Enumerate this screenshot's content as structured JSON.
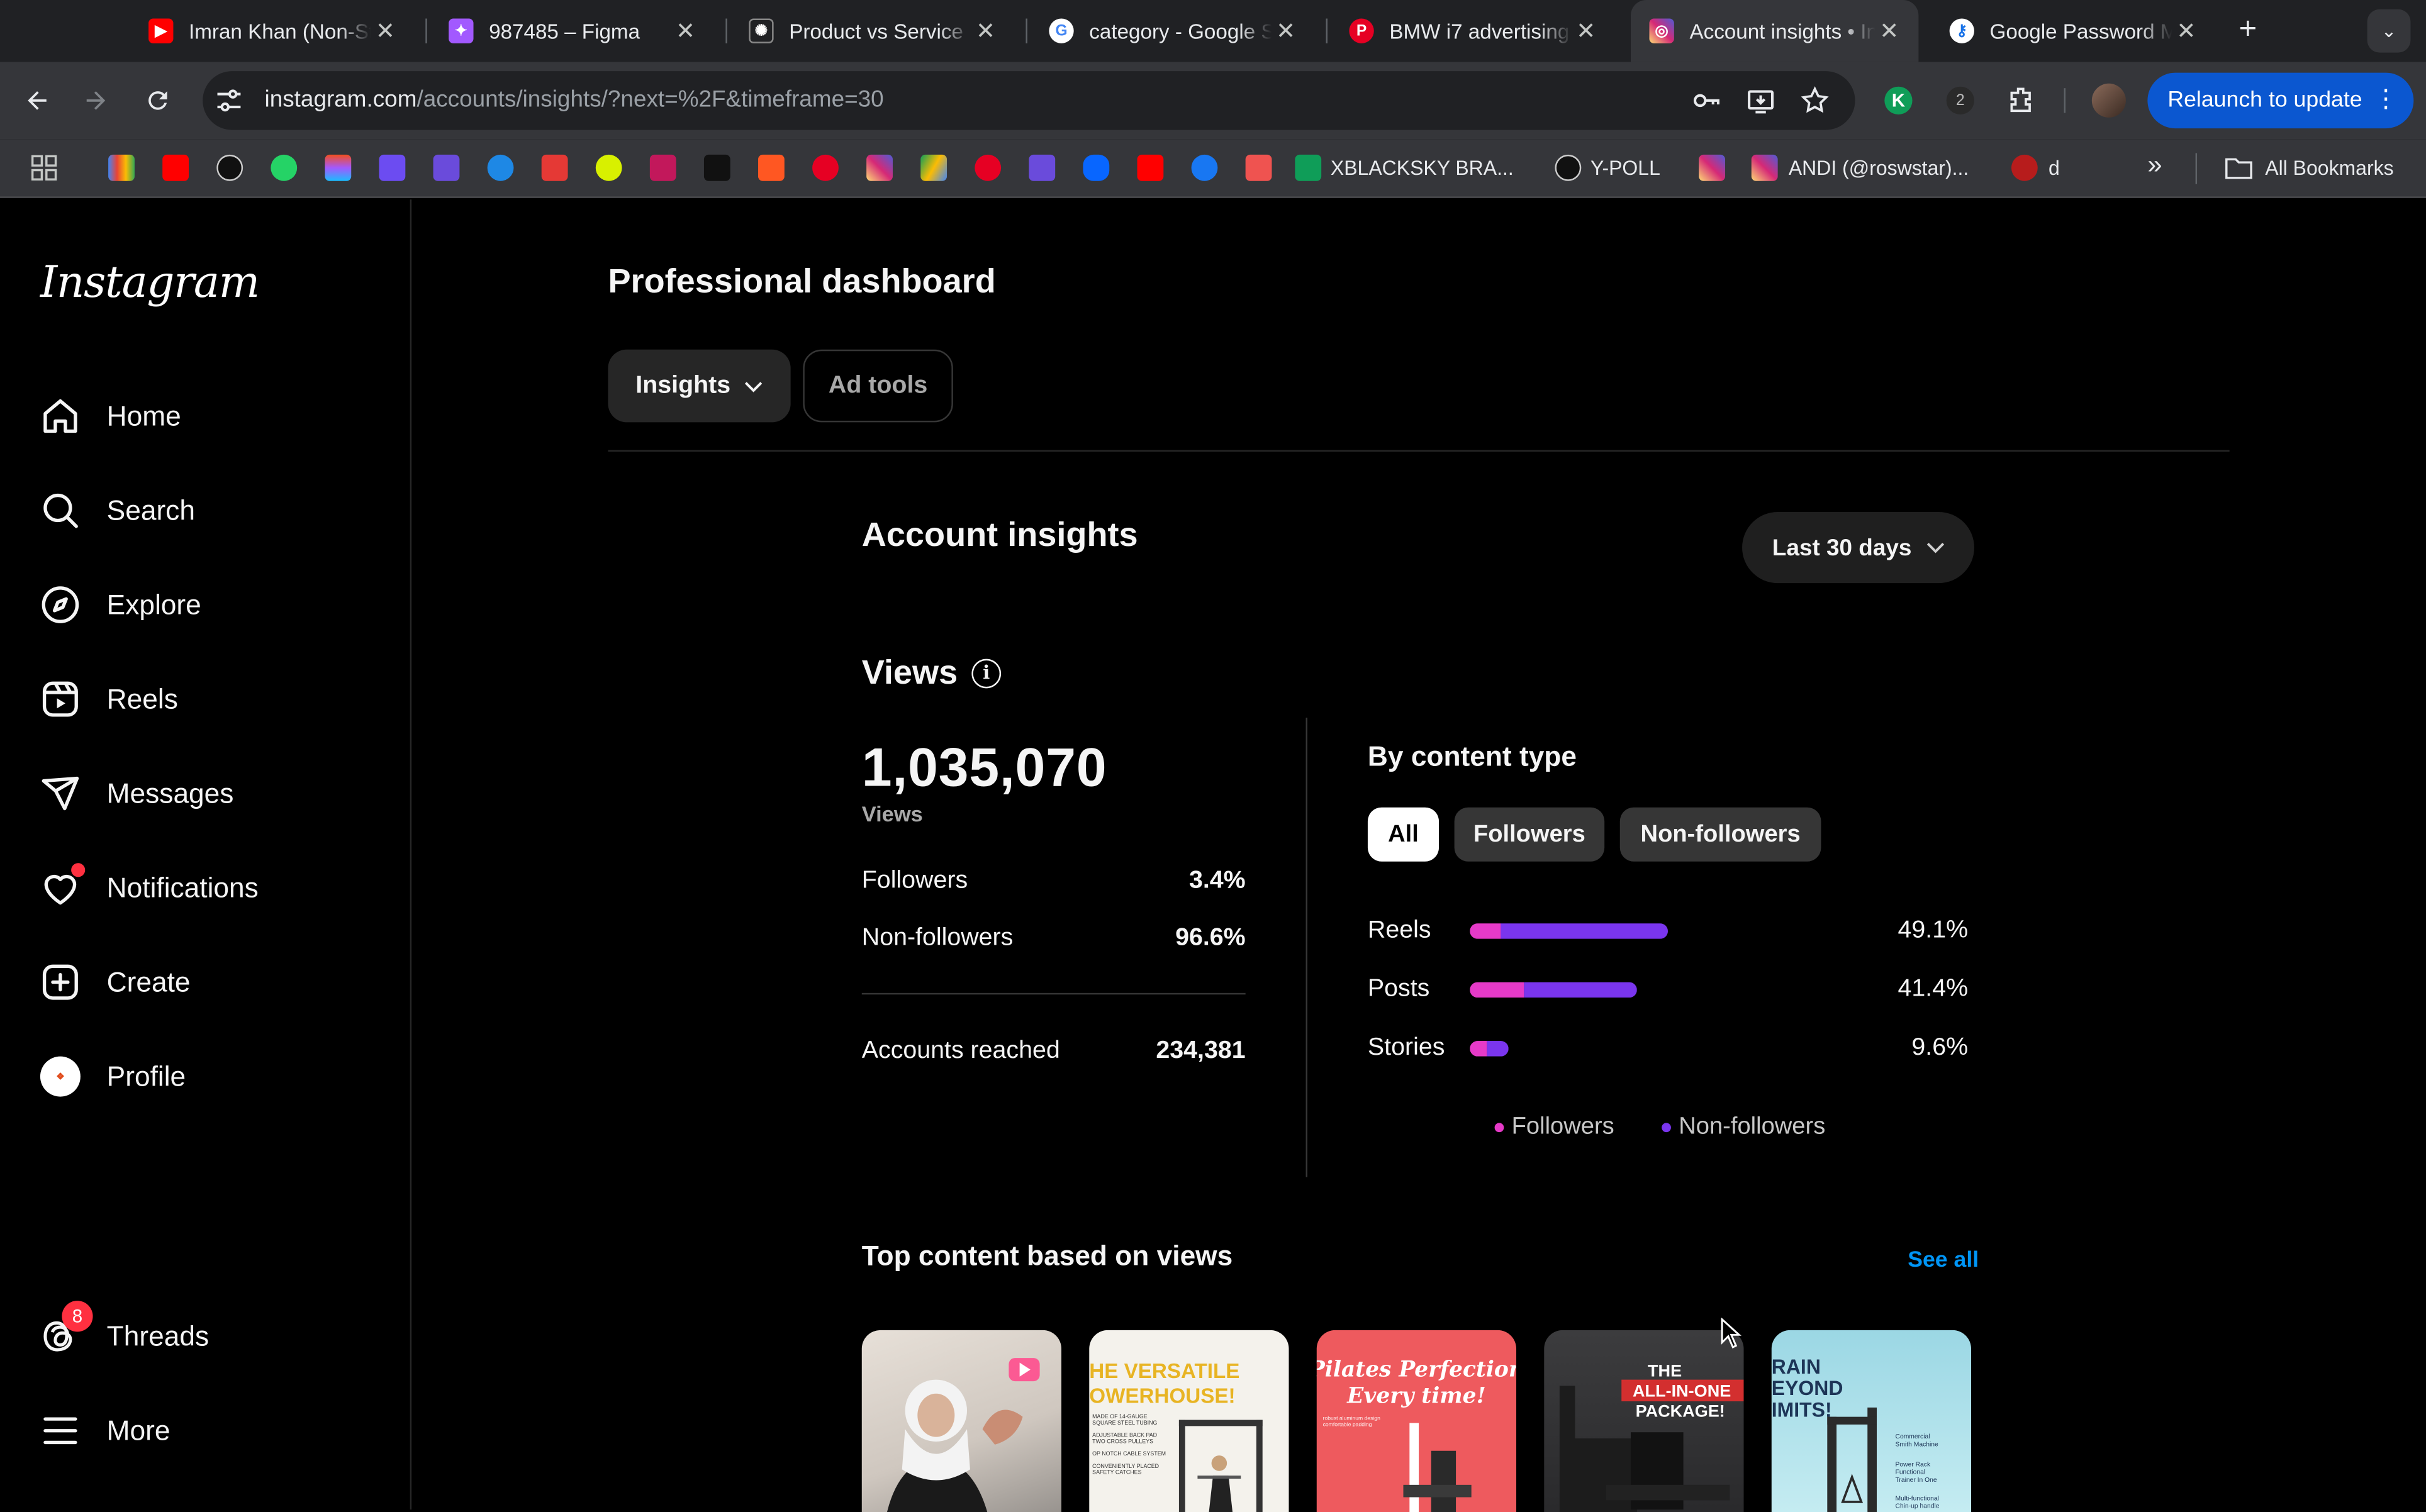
{
  "browser": {
    "tabs": [
      {
        "title": "Imran Khan (Non-Stop",
        "fav_color": "#ff0000",
        "fav_glyph": "▶"
      },
      {
        "title": "987485 – Figma",
        "fav_color": "#a259ff",
        "fav_glyph": "✦"
      },
      {
        "title": "Product vs Service",
        "fav_color": "#202124",
        "fav_glyph": "✺"
      },
      {
        "title": "category - Google Search",
        "fav_color": "#ffffff",
        "fav_glyph": "G"
      },
      {
        "title": "BMW i7 advertising",
        "fav_color": "#e60023",
        "fav_glyph": "P"
      },
      {
        "title": "Account insights • Instagram",
        "fav_color": "#d62976",
        "fav_glyph": "◎"
      },
      {
        "title": "Google Password Manager",
        "fav_color": "#ffffff",
        "fav_glyph": "⚷"
      }
    ],
    "url_host": "instagram.com",
    "url_path": "/accounts/insights/?next=%2F&timeframe=30",
    "relaunch_label": "Relaunch to update",
    "bookmarks": [
      "XBLACKSKY BRA...",
      "Y-POLL",
      "ANDI (@roswstar)...",
      "d"
    ],
    "all_bookmarks_label": "All Bookmarks",
    "overflow_label": "»"
  },
  "sidebar": {
    "logo": "Instagram",
    "items": [
      {
        "label": "Home",
        "icon": "home-icon"
      },
      {
        "label": "Search",
        "icon": "search-icon"
      },
      {
        "label": "Explore",
        "icon": "compass-icon"
      },
      {
        "label": "Reels",
        "icon": "reels-icon"
      },
      {
        "label": "Messages",
        "icon": "send-icon"
      },
      {
        "label": "Notifications",
        "icon": "heart-icon"
      },
      {
        "label": "Create",
        "icon": "plus-square-icon"
      },
      {
        "label": "Profile",
        "icon": "avatar"
      }
    ],
    "threads_label": "Threads",
    "threads_badge": "8",
    "more_label": "More"
  },
  "dashboard": {
    "title": "Professional dashboard",
    "insights_label": "Insights",
    "adtools_label": "Ad tools"
  },
  "insights": {
    "title": "Account insights",
    "range_label": "Last 30 days",
    "views_title": "Views",
    "info_glyph": "i",
    "total_views": "1,035,070",
    "total_views_label": "Views",
    "followers_label": "Followers",
    "followers_pct": "3.4%",
    "nonfollowers_label": "Non-followers",
    "nonfollowers_pct": "96.6%",
    "reached_label": "Accounts reached",
    "reached_value": "234,381"
  },
  "by_content": {
    "title": "By content type",
    "filters": [
      "All",
      "Followers",
      "Non-followers"
    ],
    "rows": [
      {
        "label": "Reels",
        "pct": "49.1%",
        "total": 49.1,
        "followers_share": 0.16
      },
      {
        "label": "Posts",
        "pct": "41.4%",
        "total": 41.4,
        "followers_share": 0.32
      },
      {
        "label": "Stories",
        "pct": "9.6%",
        "total": 9.6,
        "followers_share": 0.45
      }
    ],
    "legend": [
      {
        "label": "Followers",
        "color": "#e63ac8"
      },
      {
        "label": "Non-followers",
        "color": "#7a35ee"
      }
    ]
  },
  "top_content": {
    "title": "Top content based on views",
    "see_all": "See all",
    "thumbs": [
      {
        "caption": ""
      },
      {
        "caption": "HE VERSATILE OWERHOUSE!"
      },
      {
        "caption": "Pilates Perfection Every time!"
      },
      {
        "caption": "THE ALL-IN-ONE PACKAGE!"
      },
      {
        "caption": "RAIN EYOND IMITS!"
      }
    ]
  },
  "colors": {
    "accent_link": "#0095f6",
    "notification_red": "#ff3040",
    "chrome_blue": "#0b57d0"
  }
}
